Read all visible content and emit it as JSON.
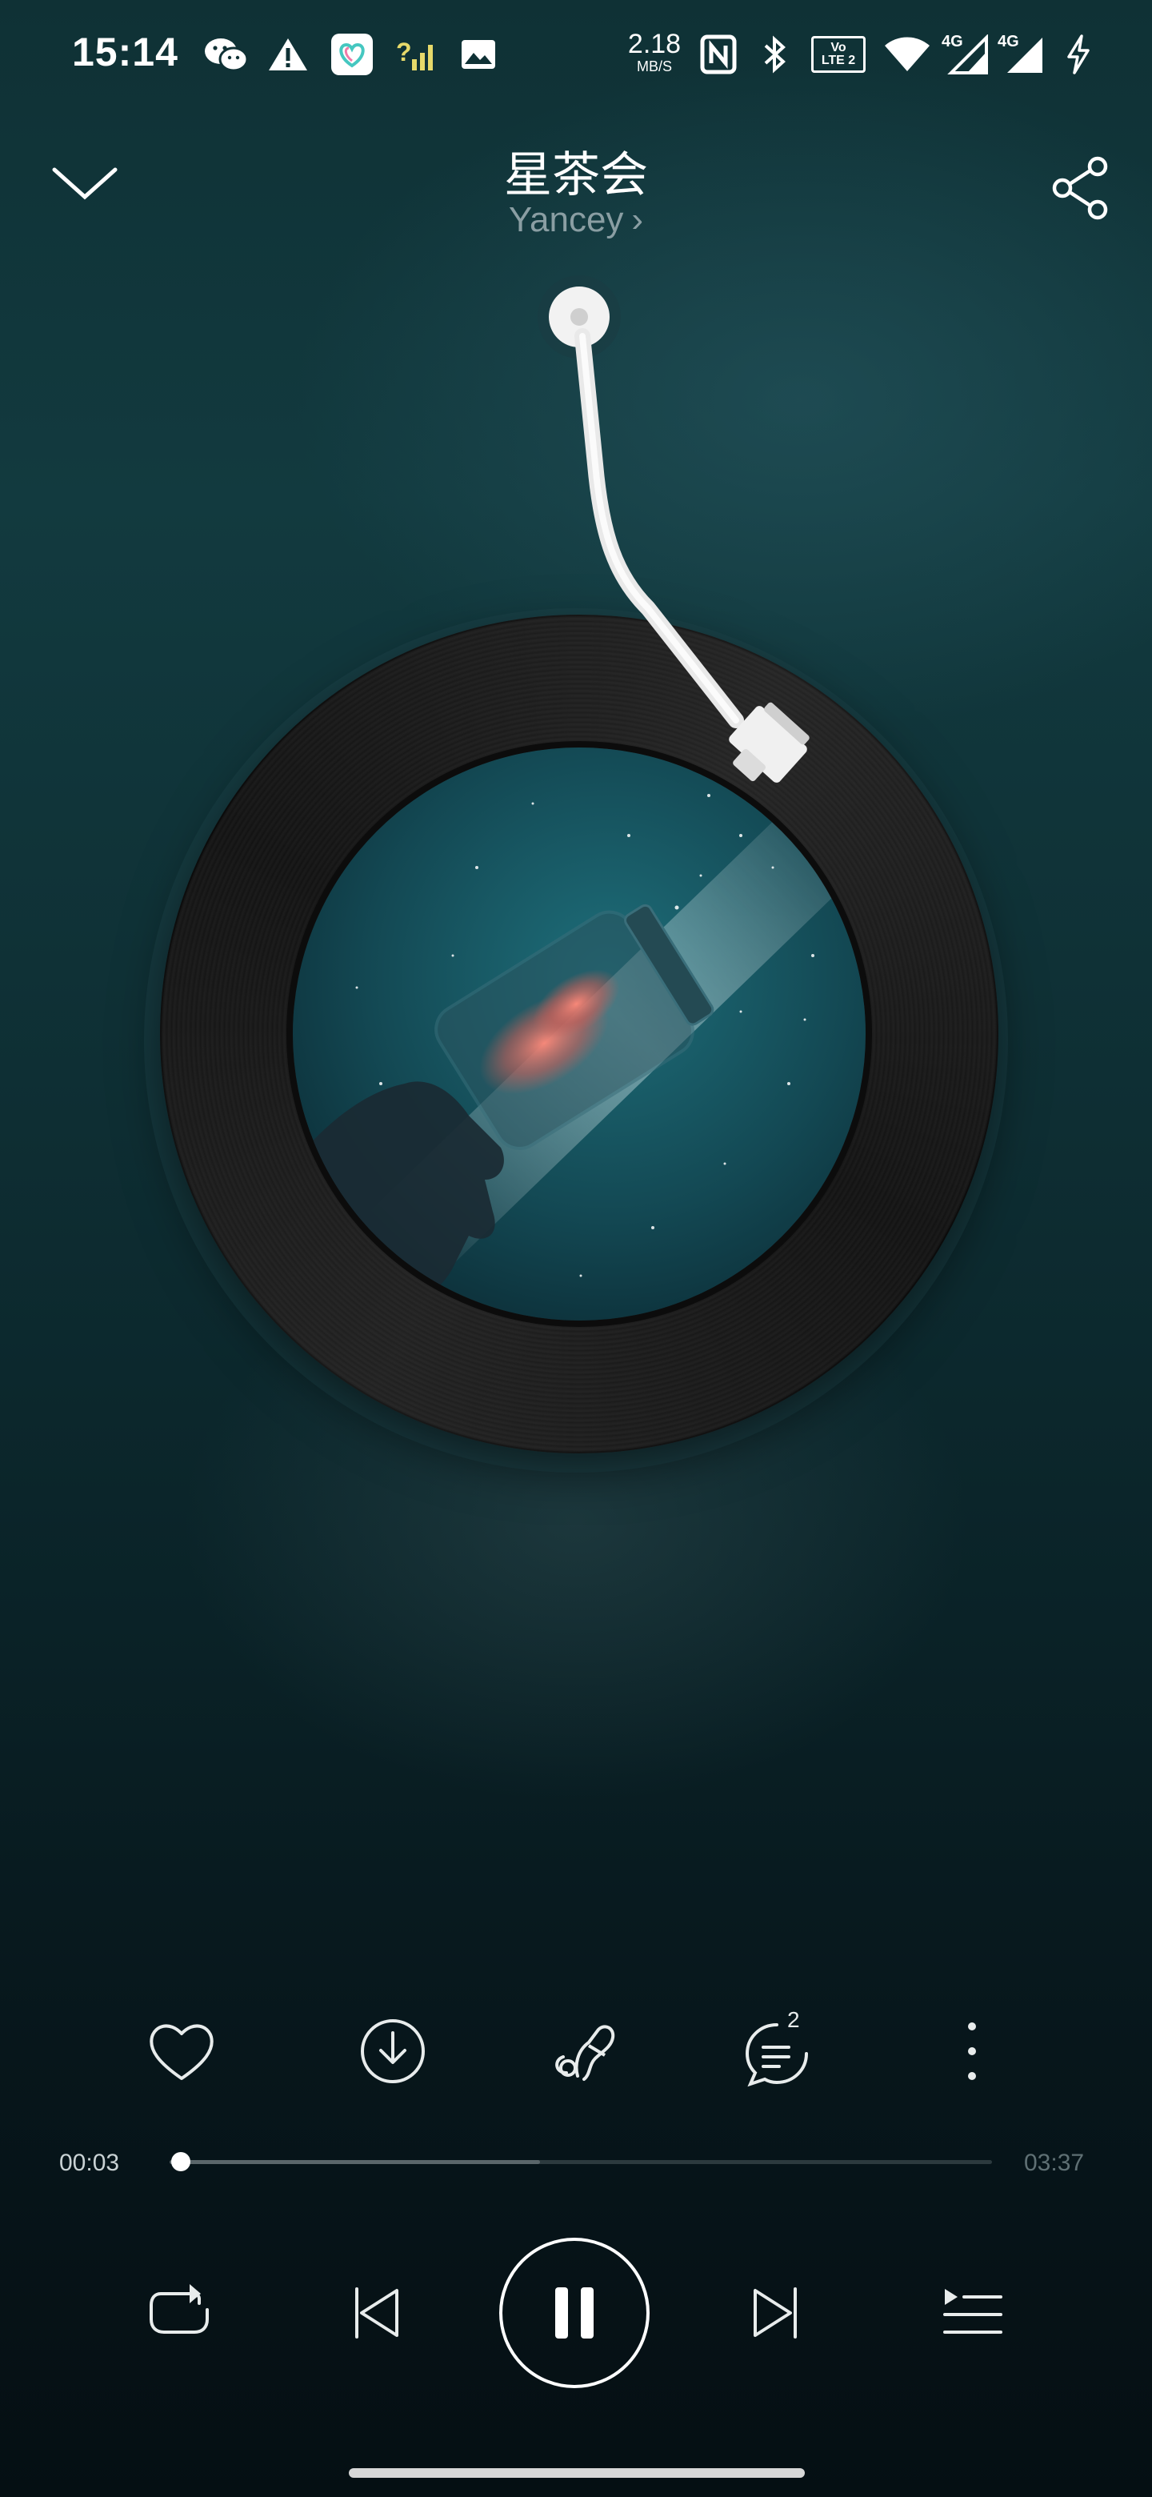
{
  "status_bar": {
    "time": "15:14",
    "net_speed_value": "2.18",
    "net_speed_unit": "MB/S",
    "volte_label_top": "Vo",
    "volte_label_bottom": "LTE 2",
    "signal_1_label": "4G",
    "signal_2_label": "4G",
    "icons": [
      "wechat-icon",
      "warning-icon",
      "app-heart-icon",
      "signal-question-icon",
      "gallery-icon",
      "nfc-icon",
      "bluetooth-icon",
      "volte-icon",
      "wifi-icon",
      "signal-icon",
      "signal-icon",
      "charging-icon"
    ]
  },
  "header": {
    "song_title": "星茶会",
    "artist": "Yancey",
    "artist_chevron": "›"
  },
  "actions": {
    "comments_count": "2",
    "icons": [
      "heart-icon",
      "download-icon",
      "effects-icon",
      "comments-icon",
      "more-icon"
    ]
  },
  "progress": {
    "current_time": "00:03",
    "total_time": "03:37",
    "played_fraction": 0.014,
    "buffered_fraction": 0.45
  },
  "controls": {
    "icons": [
      "repeat-icon",
      "previous-icon",
      "pause-icon",
      "next-icon",
      "playlist-icon"
    ]
  },
  "colors": {
    "accent": "#ffffff",
    "muted_text": "#8a9ea3",
    "background_top": "#0f3135",
    "background_bottom": "#050f13"
  }
}
